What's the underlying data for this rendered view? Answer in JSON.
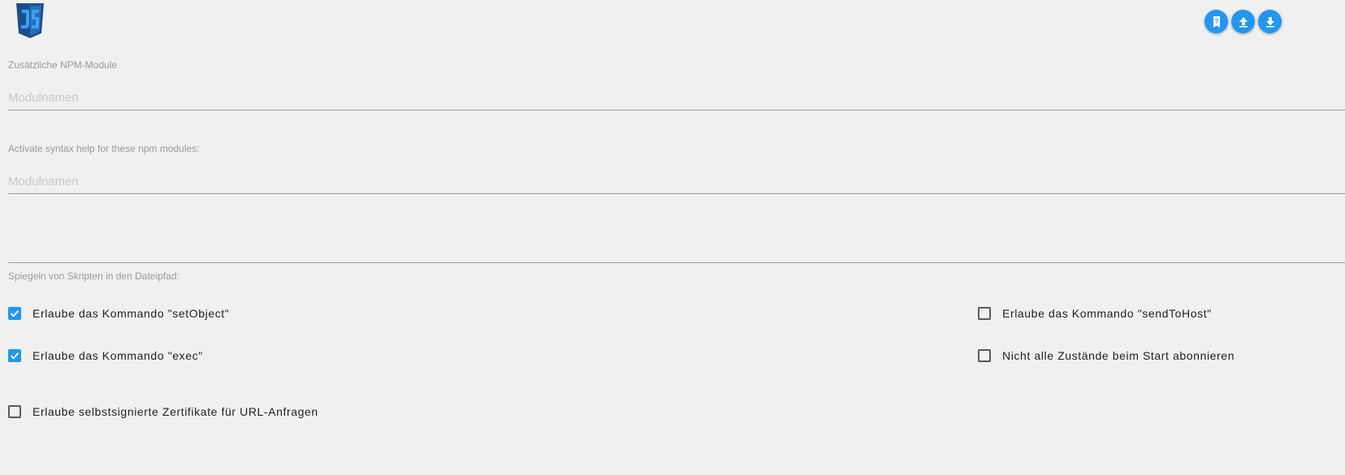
{
  "header": {
    "logo_icon": "javascript-logo-icon",
    "buttons": [
      {
        "name": "help-button",
        "icon": "help-document-icon"
      },
      {
        "name": "upload-button",
        "icon": "upload-icon"
      },
      {
        "name": "download-button",
        "icon": "download-icon"
      }
    ]
  },
  "npm_modules": {
    "label": "Zusätzliche NPM-Module",
    "placeholder": "Modulnamen",
    "value": ""
  },
  "syntax_help": {
    "label": "Activate syntax help for these npm modules:",
    "placeholder": "Modulnamen",
    "value": ""
  },
  "mirror_path": {
    "label": "Spiegeln von Skripten in den Dateipfad:",
    "value": ""
  },
  "options": {
    "set_object": {
      "label": "Erlaube das Kommando \"setObject\"",
      "checked": true
    },
    "send_to_host": {
      "label": "Erlaube das Kommando \"sendToHost\"",
      "checked": false
    },
    "exec": {
      "label": "Erlaube das Kommando \"exec\"",
      "checked": true
    },
    "no_subscribe": {
      "label": "Nicht alle Zustände beim Start abonnieren",
      "checked": false
    },
    "self_signed": {
      "label": "Erlaube selbstsignierte Zertifikate für URL-Anfragen",
      "checked": false
    }
  },
  "colors": {
    "accent": "#2196f3",
    "logo_dark": "#1b4f8a",
    "logo_light": "#3aa0ff",
    "background": "#f0f0f0"
  }
}
